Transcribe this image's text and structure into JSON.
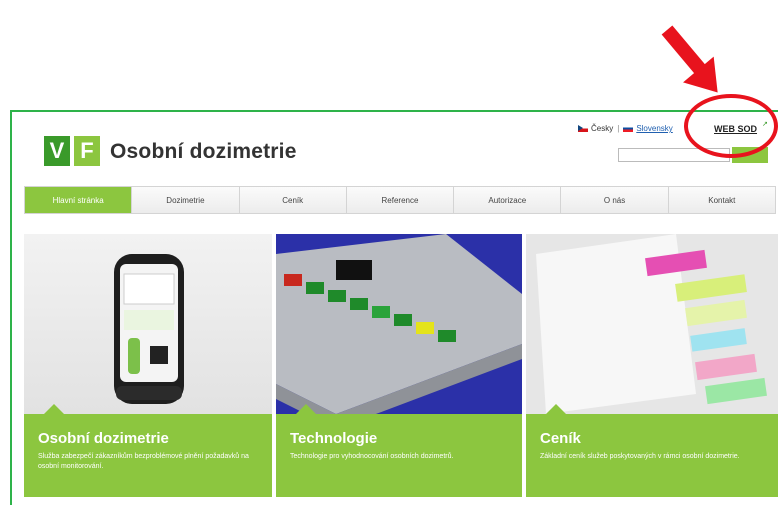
{
  "header": {
    "logo_v": "V",
    "logo_f": "F",
    "title": "Osobní dozimetrie",
    "lang_czech": "Česky",
    "lang_separator": "|",
    "lang_slovak": "Slovensky",
    "websod": "WEB SOD"
  },
  "search": {
    "placeholder": ""
  },
  "nav": {
    "items": [
      {
        "label": "Hlavní stránka"
      },
      {
        "label": "Dozimetrie"
      },
      {
        "label": "Ceník"
      },
      {
        "label": "Reference"
      },
      {
        "label": "Autorizace"
      },
      {
        "label": "O nás"
      },
      {
        "label": "Kontakt"
      }
    ]
  },
  "panels": [
    {
      "title": "Osobní dozimetrie",
      "desc": "Služba zabezpečí zákazníkům bezproblémové plnění požadavků na osobní monitorování."
    },
    {
      "title": "Technologie",
      "desc": "Technologie pro vyhodnocování osobních dozimetrů."
    },
    {
      "title": "Ceník",
      "desc": "Základní ceník služeb poskytovaných v rámci osobní dozimetrie."
    }
  ],
  "colors": {
    "accent_green": "#8cc63f",
    "frame_green": "#2eb34a",
    "annotation_red": "#e8131d"
  }
}
